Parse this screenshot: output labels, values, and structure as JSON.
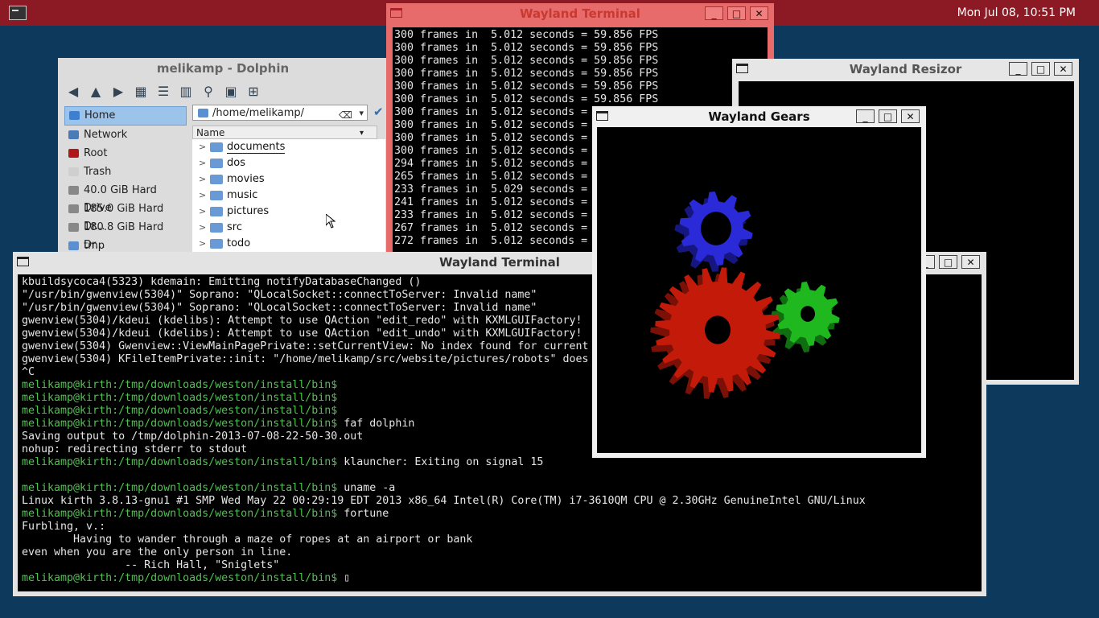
{
  "panel": {
    "clock": "Mon Jul 08, 10:51 PM",
    "launcher_icon": "terminal-launcher-icon"
  },
  "fps_terminal": {
    "title": "Wayland Terminal",
    "lines": [
      "300 frames in  5.012 seconds = 59.856 FPS",
      "300 frames in  5.012 seconds = 59.856 FPS",
      "300 frames in  5.012 seconds = 59.856 FPS",
      "300 frames in  5.012 seconds = 59.856 FPS",
      "300 frames in  5.012 seconds = 59.856 FPS",
      "300 frames in  5.012 seconds = 59.856 FPS",
      "300 frames in  5.012 seconds = 59.856 FPS",
      "300 frames in  5.012 seconds = 59.856 FPS",
      "300 frames in  5.012 seconds = 59.856 FPS",
      "300 frames in  5.012 seconds = 59.856 FPS",
      "294 frames in  5.012 seconds = 58.659 FPS",
      "265 frames in  5.012 seconds = 52.873 FPS",
      "233 frames in  5.029 seconds = 46.331 FPS",
      "241 frames in  5.012 seconds = 48.085 FPS",
      "233 frames in  5.012 seconds = 46.488 FPS",
      "267 frames in  5.012 seconds = 53.272 FPS",
      "272 frames in  5.012 seconds = 54.270 FPS"
    ]
  },
  "dolphin": {
    "title": "melikamp - Dolphin",
    "location": "/home/melikamp/",
    "column_header": "Name",
    "places": [
      {
        "label": "Home",
        "selected": true,
        "color": "#3f7fcf"
      },
      {
        "label": "Network",
        "selected": false,
        "color": "#4a7ab8"
      },
      {
        "label": "Root",
        "selected": false,
        "color": "#b01818"
      },
      {
        "label": "Trash",
        "selected": false,
        "color": "#cfcfcf"
      },
      {
        "label": "40.0 GiB Hard Drive",
        "selected": false,
        "color": "#888888"
      },
      {
        "label": "185.0 GiB Hard Dr...",
        "selected": false,
        "color": "#888888"
      },
      {
        "label": "180.8 GiB Hard Dr...",
        "selected": false,
        "color": "#888888"
      },
      {
        "label": "tmp",
        "selected": false,
        "color": "#5a8fd1"
      }
    ],
    "files": [
      "documents",
      "dos",
      "movies",
      "music",
      "pictures",
      "src",
      "todo"
    ]
  },
  "resizor": {
    "title": "Wayland Resizor"
  },
  "main_terminal": {
    "title": "Wayland Terminal",
    "lines": [
      {
        "text": "kbuildsycoca4(5323) kdemain: Emitting notifyDatabaseChanged ()",
        "prompt": false
      },
      {
        "text": "\"/usr/bin/gwenview(5304)\" Soprano: \"QLocalSocket::connectToServer: Invalid name\"",
        "prompt": false
      },
      {
        "text": "\"/usr/bin/gwenview(5304)\" Soprano: \"QLocalSocket::connectToServer: Invalid name\"",
        "prompt": false
      },
      {
        "text": "gwenview(5304)/kdeui (kdelibs): Attempt to use QAction \"edit_redo\" with KXMLGUIFactory!",
        "prompt": false
      },
      {
        "text": "gwenview(5304)/kdeui (kdelibs): Attempt to use QAction \"edit_undo\" with KXMLGUIFactory!",
        "prompt": false
      },
      {
        "text": "gwenview(5304) Gwenview::ViewMainPagePrivate::setCurrentView: No index found for current",
        "prompt": false
      },
      {
        "text": "gwenview(5304) KFileItemPrivate::init: \"/home/melikamp/src/website/pictures/robots\" does not exist",
        "prompt": false
      },
      {
        "text": "^C",
        "prompt": false
      },
      {
        "text": "melikamp@kirth:/tmp/downloads/weston/install/bin$",
        "prompt": true,
        "cmd": ""
      },
      {
        "text": "melikamp@kirth:/tmp/downloads/weston/install/bin$",
        "prompt": true,
        "cmd": ""
      },
      {
        "text": "melikamp@kirth:/tmp/downloads/weston/install/bin$",
        "prompt": true,
        "cmd": ""
      },
      {
        "text": "melikamp@kirth:/tmp/downloads/weston/install/bin$",
        "prompt": true,
        "cmd": " faf dolphin"
      },
      {
        "text": "Saving output to /tmp/dolphin-2013-07-08-22-50-30.out",
        "prompt": false
      },
      {
        "text": "nohup: redirecting stderr to stdout",
        "prompt": false
      },
      {
        "text": "melikamp@kirth:/tmp/downloads/weston/install/bin$",
        "prompt": true,
        "cmd": " klauncher: Exiting on signal 15"
      },
      {
        "text": "",
        "prompt": false
      },
      {
        "text": "melikamp@kirth:/tmp/downloads/weston/install/bin$",
        "prompt": true,
        "cmd": " uname -a"
      },
      {
        "text": "Linux kirth 3.8.13-gnu1 #1 SMP Wed May 22 00:29:19 EDT 2013 x86_64 Intel(R) Core(TM) i7-3610QM CPU @ 2.30GHz GenuineIntel GNU/Linux",
        "prompt": false
      },
      {
        "text": "melikamp@kirth:/tmp/downloads/weston/install/bin$",
        "prompt": true,
        "cmd": " fortune"
      },
      {
        "text": "Furbling, v.:",
        "prompt": false
      },
      {
        "text": "        Having to wander through a maze of ropes at an airport or bank",
        "prompt": false
      },
      {
        "text": "even when you are the only person in line.",
        "prompt": false
      },
      {
        "text": "                -- Rich Hall, \"Sniglets\"",
        "prompt": false
      },
      {
        "text": "melikamp@kirth:/tmp/downloads/weston/install/bin$",
        "prompt": true,
        "cmd": " ▯"
      }
    ]
  },
  "gears": {
    "title": "Wayland Gears",
    "colors": {
      "red": "#c41a0a",
      "green": "#1fb81f",
      "blue": "#2a2ad8"
    }
  }
}
